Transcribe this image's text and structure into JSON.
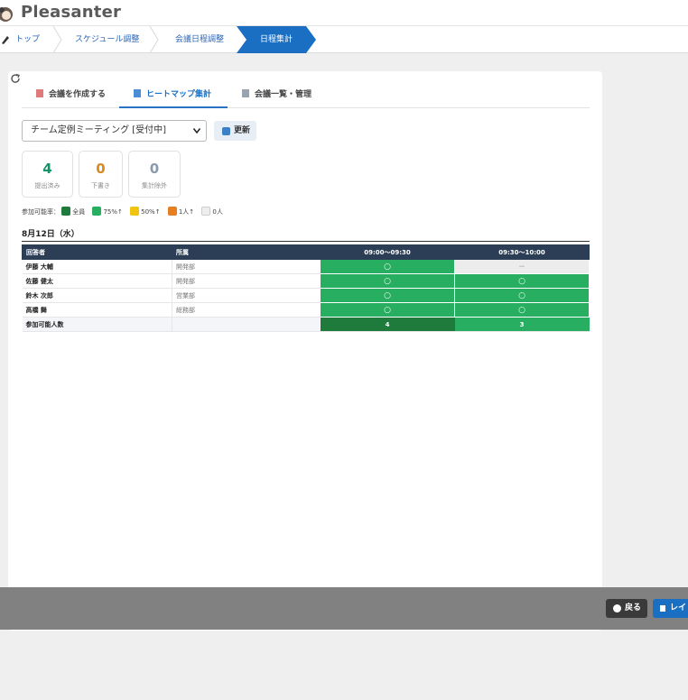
{
  "app": {
    "name": "Pleasanter"
  },
  "breadcrumbs": [
    {
      "label": "トップ"
    },
    {
      "label": "スケジュール調整"
    },
    {
      "label": "会議日程調整"
    },
    {
      "label": "日程集計"
    }
  ],
  "tabs": [
    {
      "label": "会議を作成する",
      "icon": "document-edit-icon"
    },
    {
      "label": "ヒートマップ集計",
      "icon": "bar-chart-icon",
      "active": true
    },
    {
      "label": "会議一覧・管理",
      "icon": "list-icon"
    }
  ],
  "meeting_select": {
    "value": "チーム定例ミーティング [受付中]"
  },
  "update_button": {
    "label": "更新"
  },
  "stats": [
    {
      "value": "4",
      "label": "提出済み",
      "color": "#16936b"
    },
    {
      "value": "0",
      "label": "下書き",
      "color": "#d88a1f"
    },
    {
      "value": "0",
      "label": "集計除外",
      "color": "#8a9aac"
    }
  ],
  "legend": {
    "title": "参加可能率：",
    "items": [
      {
        "label": "全員",
        "color": "#1e7b3c"
      },
      {
        "label": "75%↑",
        "color": "#27ae60"
      },
      {
        "label": "50%↑",
        "color": "#f1c40f"
      },
      {
        "label": "1人↑",
        "color": "#e67e22"
      },
      {
        "label": "0人",
        "color": "#eeeeee"
      }
    ]
  },
  "date_heading": "8月12日（水）",
  "table": {
    "headers": [
      "回答者",
      "所属",
      "09:00〜09:30",
      "09:30〜10:00"
    ],
    "rows": [
      {
        "name": "伊藤 大輔",
        "dept": "開発部",
        "slots": [
          "○",
          "−"
        ]
      },
      {
        "name": "佐藤 健太",
        "dept": "開発部",
        "slots": [
          "○",
          "○"
        ]
      },
      {
        "name": "鈴木 次郎",
        "dept": "営業部",
        "slots": [
          "○",
          "○"
        ]
      },
      {
        "name": "高橋 舞",
        "dept": "総務部",
        "slots": [
          "○",
          "○"
        ]
      }
    ],
    "total": {
      "label": "参加可能人数",
      "values": [
        "4",
        "3"
      ]
    }
  },
  "footer": {
    "back_label": "戻る",
    "layout_label": "レイ"
  }
}
